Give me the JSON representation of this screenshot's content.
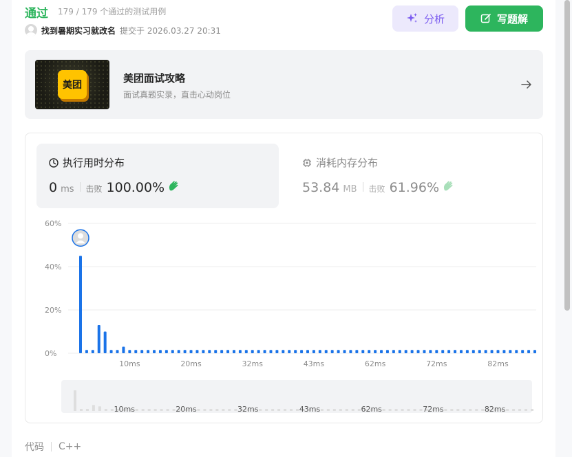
{
  "header": {
    "status": "通过",
    "passed_text": "179 / 179 个通过的测试用例",
    "username": "找到暑期实习就改名",
    "submitted_text": "提交于 2026.03.27 20:31",
    "analyze_label": "分析",
    "write_solution_label": "写题解"
  },
  "promo": {
    "logo_text": "美团",
    "title": "美团面试攻略",
    "subtitle": "面试真题实录，直击心动岗位"
  },
  "runtime": {
    "title": "执行用时分布",
    "value": "0",
    "unit": "ms",
    "beat_label": "击败",
    "beat_percent": "100.00%"
  },
  "memory": {
    "title": "消耗内存分布",
    "value": "53.84",
    "unit": "MB",
    "beat_label": "击败",
    "beat_percent": "61.96%"
  },
  "chart_data": {
    "type": "bar",
    "ylabel": "",
    "xlabel": "",
    "ylim": [
      0,
      60
    ],
    "y_ticks": [
      "60%",
      "40%",
      "20%",
      "0%"
    ],
    "x_ticks": [
      "10ms",
      "20ms",
      "32ms",
      "43ms",
      "62ms",
      "72ms",
      "82ms"
    ],
    "values": [
      45,
      1.5,
      1.5,
      13,
      10,
      1.5,
      1.5,
      3,
      1.5,
      1.5,
      1.5,
      1.5,
      1.5,
      1.5,
      1.5,
      1.5,
      1.5,
      1.5,
      1.5,
      1.5,
      1.5,
      1.5,
      1.5,
      1.5,
      1.5,
      1.5,
      1.5,
      1.5,
      1.5,
      1.5,
      1.5,
      1.5,
      1.5,
      1.5,
      1.5,
      1.5,
      1.5,
      1.5,
      1.5,
      1.5,
      1.5,
      1.5,
      1.5,
      1.5,
      1.5,
      1.5,
      1.5,
      1.5,
      1.5,
      1.5,
      1.5,
      1.5,
      1.5,
      1.5,
      1.5,
      1.5,
      1.5,
      1.5,
      1.5,
      1.5,
      1.5,
      1.5,
      1.5,
      1.5,
      1.5,
      1.5,
      1.5,
      1.5,
      1.5,
      1.5,
      1.5,
      1.5,
      1.5,
      1.5,
      1.5
    ],
    "highlight_index": 0,
    "bar_color": "#1a73e8"
  },
  "code": {
    "label": "代码",
    "language": "C++"
  },
  "colors": {
    "accent_green": "#2db55d",
    "analyze_purple": "#7b5cf0",
    "bar_blue": "#1a73e8"
  }
}
